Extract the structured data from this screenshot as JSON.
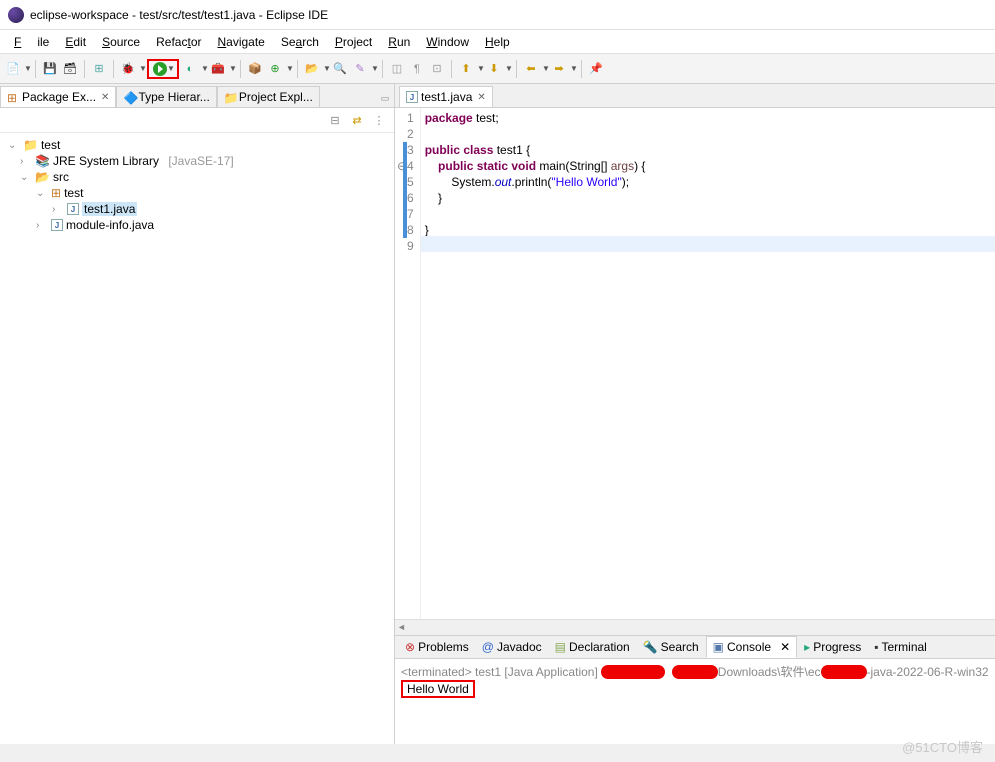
{
  "title": "eclipse-workspace - test/src/test/test1.java - Eclipse IDE",
  "menu": {
    "file": "File",
    "edit": "Edit",
    "source": "Source",
    "refactor": "Refactor",
    "navigate": "Navigate",
    "search": "Search",
    "project": "Project",
    "run": "Run",
    "window": "Window",
    "help": "Help"
  },
  "leftTabs": {
    "pkg": "Package Ex...",
    "hier": "Type Hierar...",
    "proj": "Project Expl..."
  },
  "tree": {
    "root": "test",
    "jre": "JRE System Library",
    "jreSuffix": "[JavaSE-17]",
    "src": "src",
    "pkg": "test",
    "file1": "test1.java",
    "file2": "module-info.java"
  },
  "editorTab": "test1.java",
  "code": {
    "l1": "package test;",
    "l3_a": "public class ",
    "l3_b": "test1 {",
    "l4_a": "    public static void ",
    "l4_b": "main",
    "l4_c": "(String[] ",
    "l4_d": "args",
    "l4_e": ") {",
    "l5_a": "        System.",
    "l5_b": "out",
    "l5_c": ".println(",
    "l5_d": "\"Hello World\"",
    "l5_e": ");",
    "l6": "    }",
    "l8": "}"
  },
  "lineNums": [
    "1",
    "2",
    "3",
    "4",
    "5",
    "6",
    "7",
    "8",
    "9"
  ],
  "bottomTabs": {
    "problems": "Problems",
    "javadoc": "Javadoc",
    "declaration": "Declaration",
    "search": "Search",
    "console": "Console",
    "progress": "Progress",
    "terminal": "Terminal"
  },
  "console": {
    "header_a": "<terminated> test1 [Java Application] ",
    "header_b": "Downloads\\软件\\ec",
    "header_c": "-java-2022-06-R-win32",
    "output": "Hello World"
  },
  "watermark": "@51CTO博客"
}
